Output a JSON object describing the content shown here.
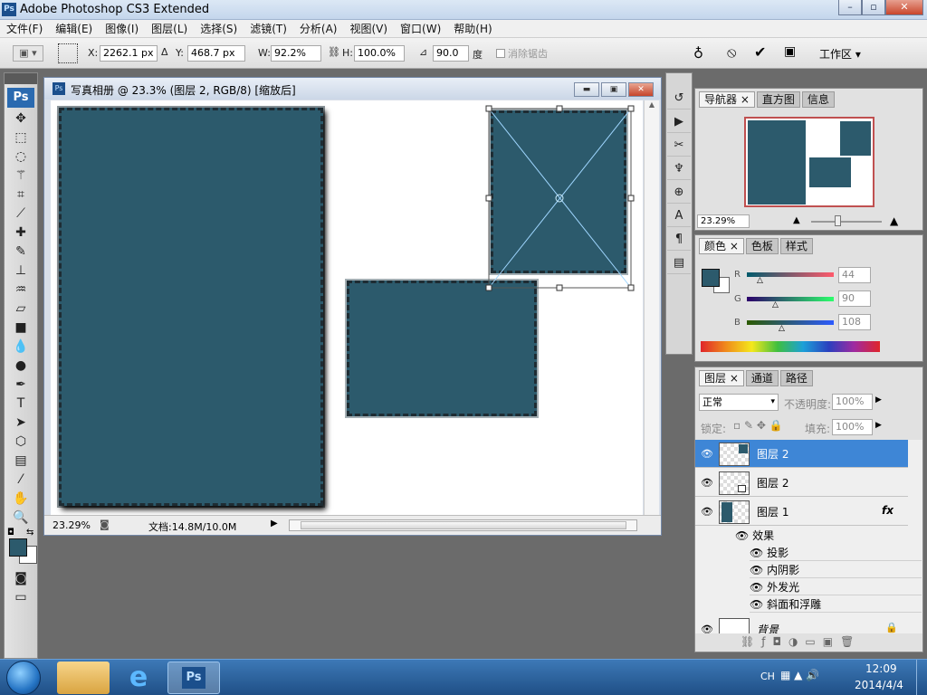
{
  "window": {
    "title": "Adobe Photoshop CS3 Extended",
    "app_icon": "Ps"
  },
  "menu": [
    "文件(F)",
    "编辑(E)",
    "图像(I)",
    "图层(L)",
    "选择(S)",
    "滤镜(T)",
    "分析(A)",
    "视图(V)",
    "窗口(W)",
    "帮助(H)"
  ],
  "options": {
    "x_label": "X:",
    "x_value": "2262.1 px",
    "y_label": "Y:",
    "y_value": "468.7 px",
    "w_label": "W:",
    "w_value": "92.2%",
    "h_label": "H:",
    "h_value": "100.0%",
    "angle_value": "90.0",
    "angle_unit": "度",
    "antialias_label": "消除锯齿",
    "workspace_label": "工作区 ▾"
  },
  "toolbox": {
    "logo": "Ps"
  },
  "document": {
    "title": "写真相册 @ 23.3% (图层 2, RGB/8) [缩放后]",
    "zoom": "23.29%",
    "doc_info": "文档:14.8M/10.0M"
  },
  "navigator": {
    "tabs": [
      "导航器",
      "直方图",
      "信息"
    ],
    "zoom": "23.29%"
  },
  "color": {
    "tabs": [
      "颜色",
      "色板",
      "样式"
    ],
    "r_label": "R",
    "r_value": "44",
    "g_label": "G",
    "g_value": "90",
    "b_label": "B",
    "b_value": "108",
    "foreground": "#2c5a6c"
  },
  "layers": {
    "tabs": [
      "图层",
      "通道",
      "路径"
    ],
    "blend_mode": "正常",
    "opacity_label": "不透明度:",
    "opacity_value": "100%",
    "lock_label": "锁定:",
    "fill_label": "填充:",
    "fill_value": "100%",
    "items": [
      {
        "name": "图层 2",
        "selected": true
      },
      {
        "name": "图层 2",
        "selected": false
      },
      {
        "name": "图层 1",
        "selected": false,
        "fx": "fx"
      }
    ],
    "effects_label": "效果",
    "effects": [
      "投影",
      "内阴影",
      "外发光",
      "斜面和浮雕"
    ],
    "background_name": "背景"
  },
  "taskbar": {
    "ps_label": "Ps",
    "lang": "CH",
    "time": "12:09",
    "date": "2014/4/4"
  }
}
